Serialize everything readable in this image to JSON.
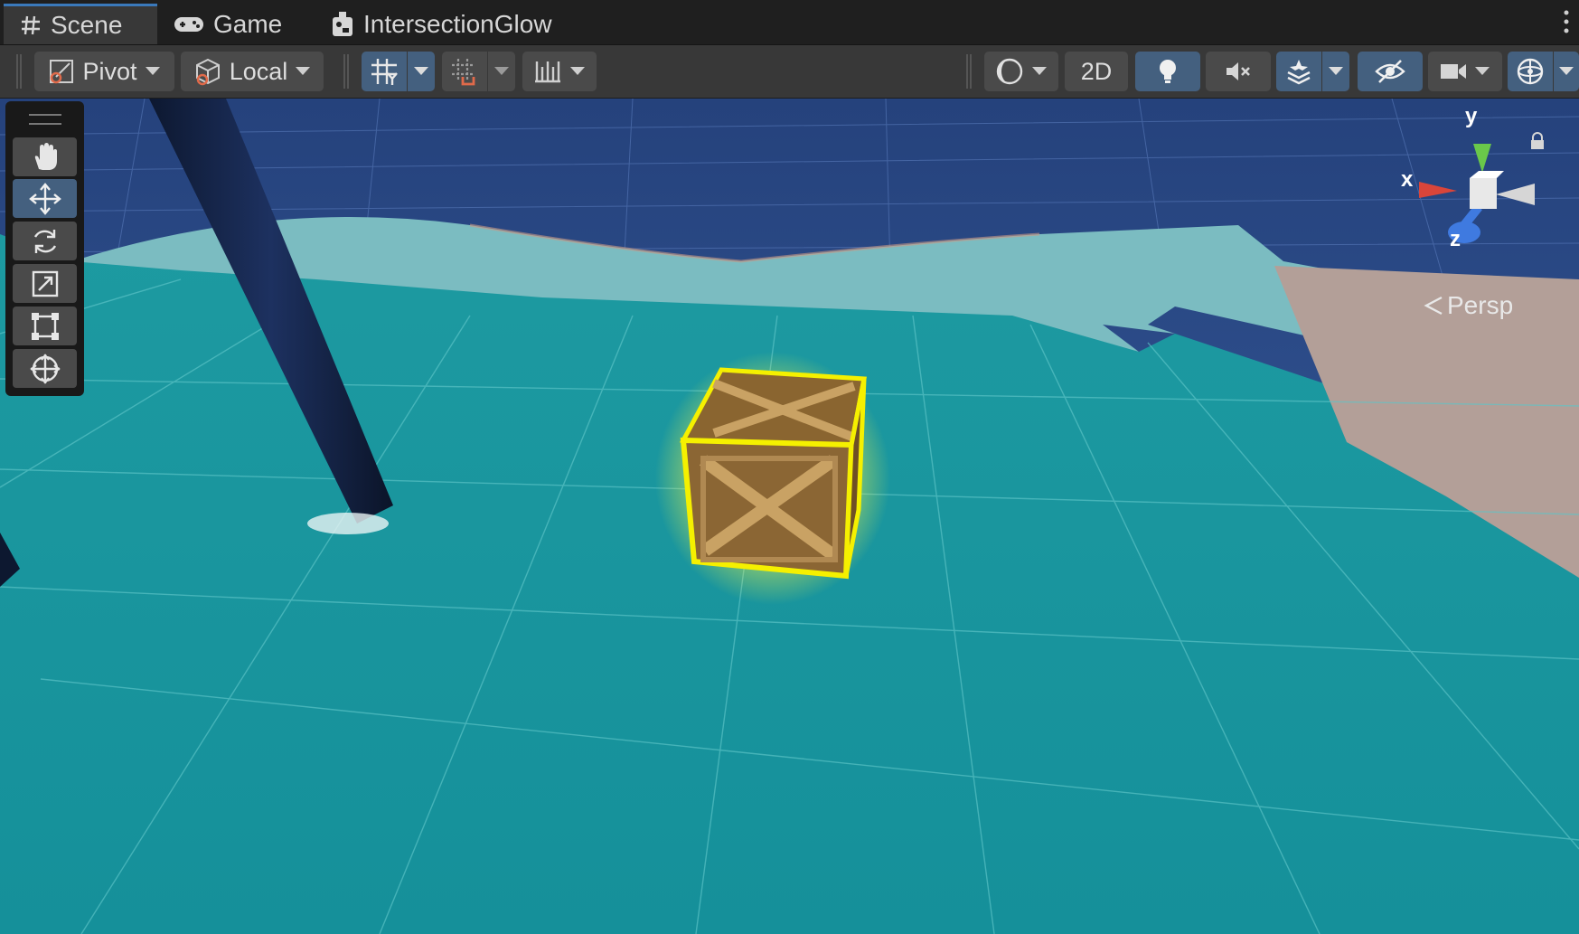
{
  "tabs": [
    {
      "label": "Scene",
      "icon": "hash-icon",
      "active": true
    },
    {
      "label": "Game",
      "icon": "gamepad-icon",
      "active": false
    },
    {
      "label": "IntersectionGlow",
      "icon": "shader-graph-icon",
      "active": false
    }
  ],
  "toolbar": {
    "pivot_label": "Pivot",
    "local_label": "Local",
    "two_d_label": "2D"
  },
  "gizmo": {
    "x_label": "x",
    "y_label": "y",
    "z_label": "z",
    "projection_label": "Persp"
  },
  "tools": [
    {
      "name": "hand-tool",
      "icon": "hand-icon"
    },
    {
      "name": "move-tool",
      "icon": "move-arrows-icon",
      "active": true
    },
    {
      "name": "rotate-tool",
      "icon": "rotate-icon"
    },
    {
      "name": "scale-tool",
      "icon": "scale-icon"
    },
    {
      "name": "rect-tool",
      "icon": "rect-transform-icon"
    },
    {
      "name": "transform-tool",
      "icon": "transform-icon"
    }
  ],
  "colors": {
    "accent": "#3a79bb",
    "active_button": "#44607f",
    "ground": "#1a9aa2",
    "glow": "#f5f000",
    "sky": "#2a4a88"
  }
}
